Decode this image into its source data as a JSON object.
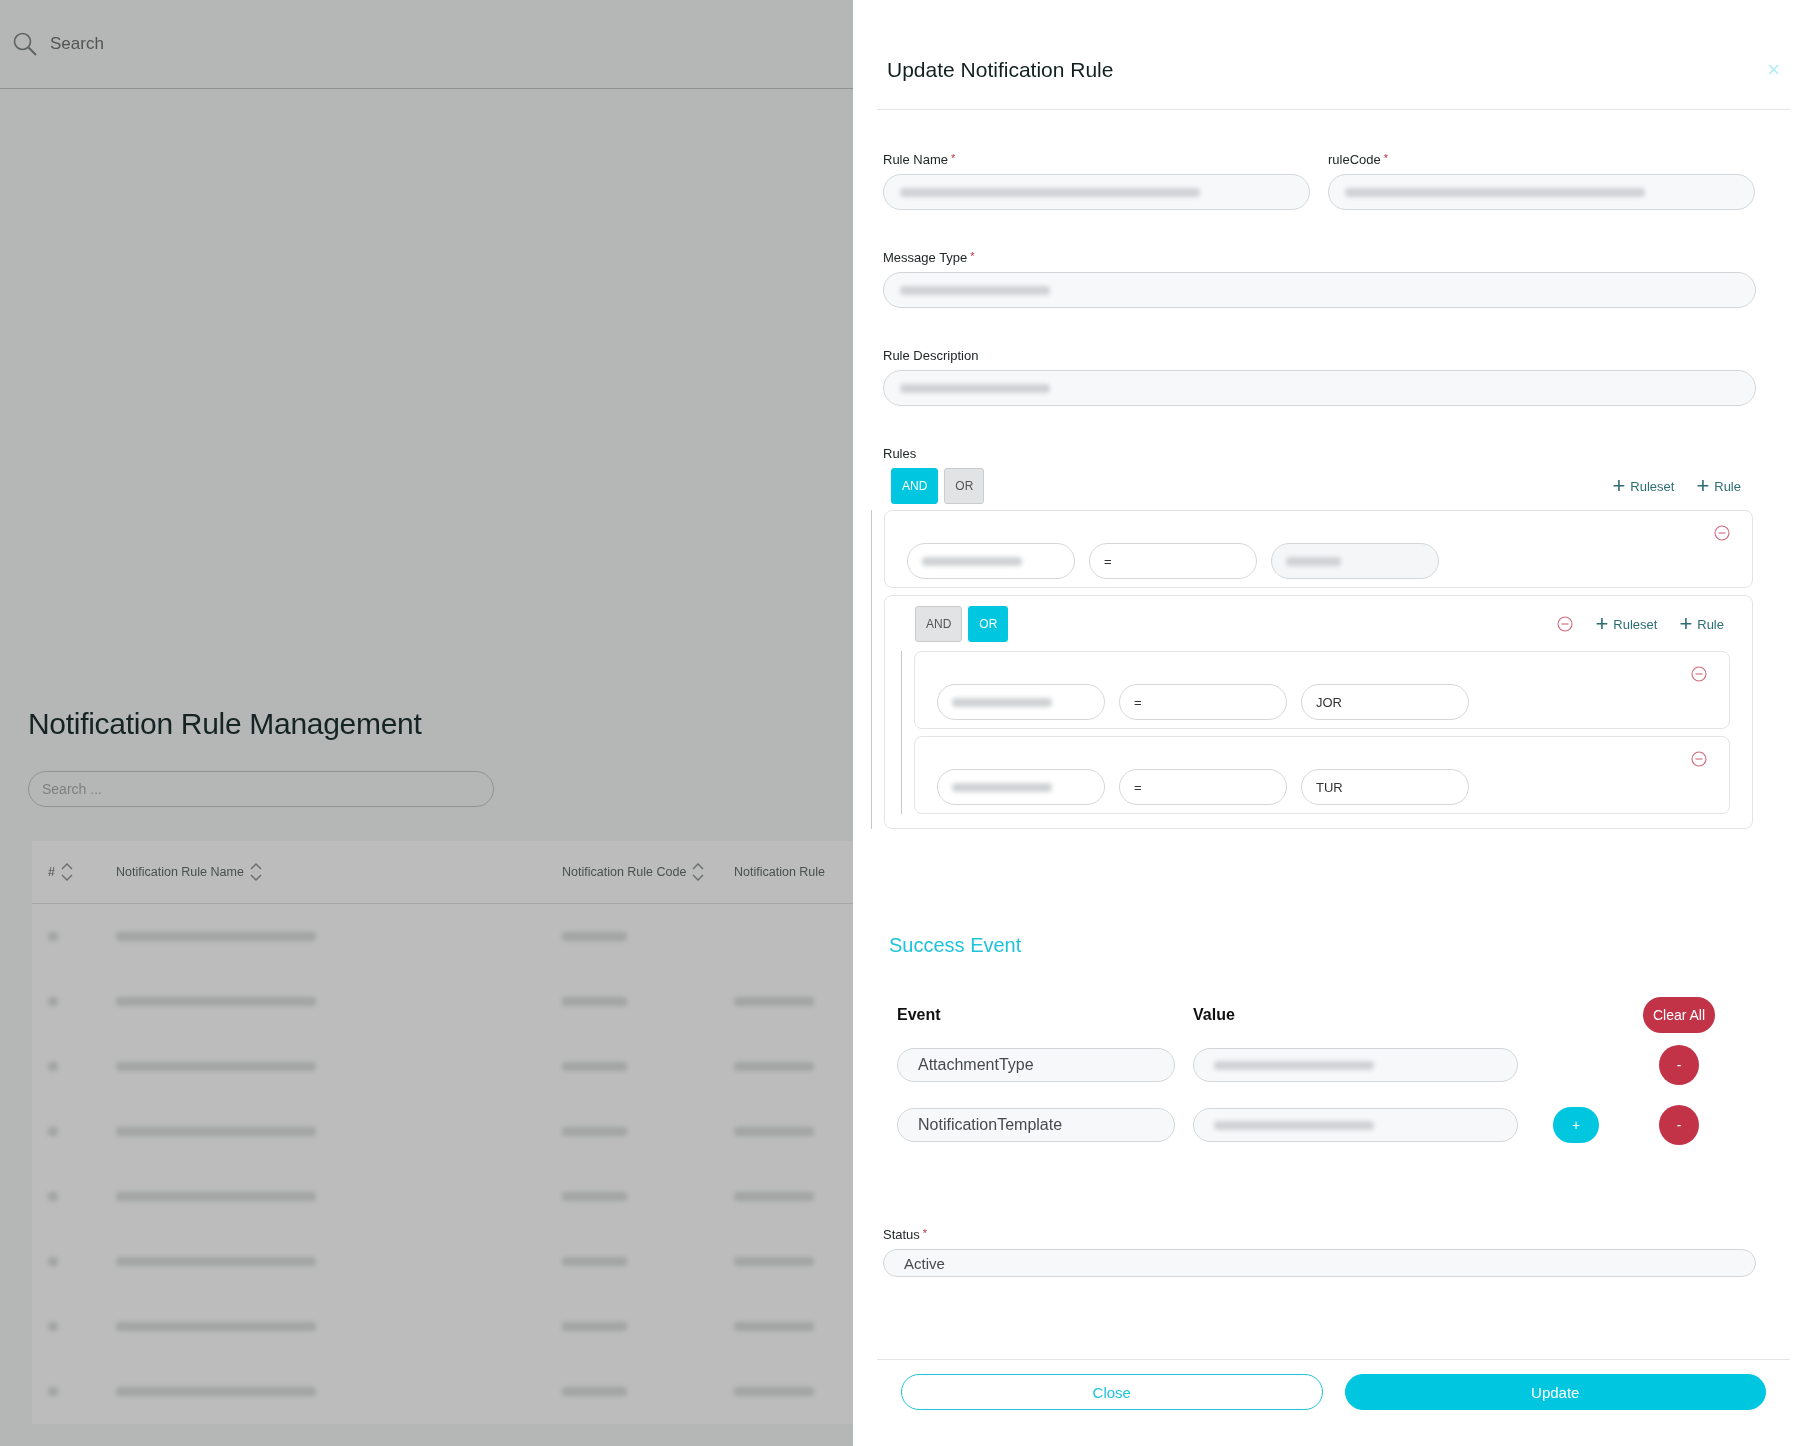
{
  "topbar": {
    "search": {
      "placeholder": "Search"
    }
  },
  "page": {
    "title": "Notification Rule Management",
    "search": {
      "placeholder": "Search ..."
    },
    "table": {
      "columns": [
        {
          "label": "#",
          "sortable": true
        },
        {
          "label": "Notification Rule Name",
          "sortable": true
        },
        {
          "label": "Notification Rule Code",
          "sortable": true
        },
        {
          "label": "Notification Rule",
          "sortable": false
        }
      ],
      "rows": [
        {
          "cells": [
            {
              "redacted": true
            },
            {
              "redacted": true
            },
            {
              "redacted": true
            },
            {
              "redacted": false
            }
          ]
        },
        {
          "cells": [
            {
              "redacted": true
            },
            {
              "redacted": true
            },
            {
              "redacted": true
            },
            {
              "redacted": true
            }
          ]
        },
        {
          "cells": [
            {
              "redacted": true
            },
            {
              "redacted": true
            },
            {
              "redacted": true
            },
            {
              "redacted": true
            }
          ]
        },
        {
          "cells": [
            {
              "redacted": true
            },
            {
              "redacted": true
            },
            {
              "redacted": true
            },
            {
              "redacted": true
            }
          ]
        },
        {
          "cells": [
            {
              "redacted": true
            },
            {
              "redacted": true
            },
            {
              "redacted": true
            },
            {
              "redacted": true
            }
          ]
        },
        {
          "cells": [
            {
              "redacted": true
            },
            {
              "redacted": true
            },
            {
              "redacted": true
            },
            {
              "redacted": true
            }
          ]
        },
        {
          "cells": [
            {
              "redacted": true
            },
            {
              "redacted": true
            },
            {
              "redacted": true
            },
            {
              "redacted": true
            }
          ]
        },
        {
          "cells": [
            {
              "redacted": true
            },
            {
              "redacted": true
            },
            {
              "redacted": true
            },
            {
              "redacted": true
            }
          ]
        }
      ]
    }
  },
  "modal": {
    "title": "Update Notification Rule",
    "close": "×",
    "fields": [
      {
        "label": "Rule Name",
        "required_mark": "*",
        "redacted": true,
        "half": true
      },
      {
        "label": "ruleCode",
        "required_mark": "*",
        "redacted": true,
        "half": true
      },
      {
        "label": "Message Type",
        "required_mark": "*",
        "redacted": true,
        "half": false
      },
      {
        "label": "Rule Description",
        "redacted": true,
        "half": false
      }
    ],
    "rules": {
      "label": "Rules",
      "ruleset": {
        "removable": false,
        "combinators": [
          {
            "label": "AND",
            "selected": true
          },
          {
            "label": "OR",
            "selected": false
          }
        ],
        "actions": [
          {
            "icon": "+",
            "label": "Ruleset"
          },
          {
            "icon": "+",
            "label": "Rule"
          }
        ],
        "children": [
          {
            "kind": "rule",
            "field": {
              "redacted": true
            },
            "operator": "=",
            "value": {
              "redacted": true
            }
          },
          {
            "kind": "ruleset",
            "removable": true,
            "combinators": [
              {
                "label": "AND",
                "selected": false
              },
              {
                "label": "OR",
                "selected": true
              }
            ],
            "actions": [
              {
                "icon": "+",
                "label": "Ruleset"
              },
              {
                "icon": "+",
                "label": "Rule"
              }
            ],
            "children": [
              {
                "kind": "rule",
                "field": {
                  "redacted": true
                },
                "operator": "=",
                "value": {
                  "text": "JOR"
                }
              },
              {
                "kind": "rule",
                "field": {
                  "redacted": true
                },
                "operator": "=",
                "value": {
                  "text": "TUR"
                }
              }
            ]
          }
        ]
      }
    },
    "success_event": {
      "title": "Success Event",
      "columns": [
        "Event",
        "Value"
      ],
      "clear_all": "Clear All",
      "rows": [
        {
          "event": "AttachmentType",
          "value": {
            "redacted": true
          },
          "remove": "-"
        },
        {
          "event": "NotificationTemplate",
          "value": {
            "redacted": true
          },
          "add": "+",
          "remove": "-"
        }
      ]
    },
    "status": {
      "label": "Status",
      "required_mark": "*",
      "value": "Active"
    },
    "buttons": [
      {
        "label": "Close",
        "kind": "secondary"
      },
      {
        "label": "Update",
        "kind": "primary"
      }
    ]
  }
}
